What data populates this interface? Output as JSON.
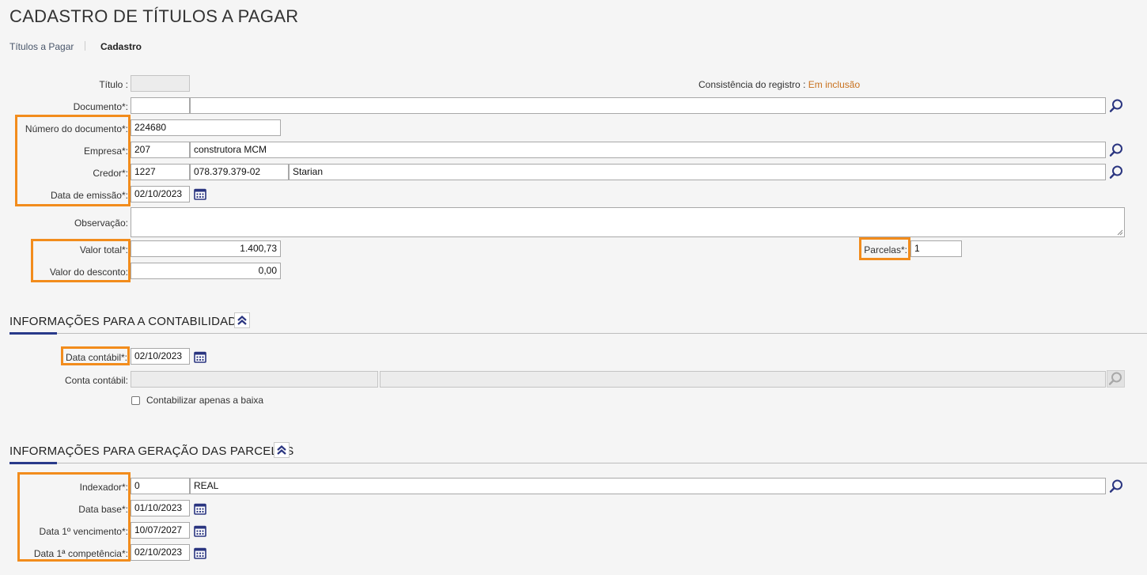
{
  "page": {
    "title": "CADASTRO DE TÍTULOS A PAGAR",
    "breadcrumb": {
      "parent": "Títulos a Pagar",
      "current": "Cadastro"
    }
  },
  "record": {
    "titulo_label": "Título :",
    "titulo_value": "",
    "consistencia_label": "Consistência do registro :",
    "consistencia_value": "Em inclusão",
    "documento_label": "Documento*:",
    "documento_code": "",
    "documento_desc": "",
    "numero_label": "Número do documento*:",
    "numero_value": "224680",
    "empresa_label": "Empresa*:",
    "empresa_code": "207",
    "empresa_name": "construtora MCM",
    "credor_label": "Credor*:",
    "credor_code": "1227",
    "credor_doc": "078.379.379-02",
    "credor_name": "Starian",
    "emissao_label": "Data de emissão*:",
    "emissao_value": "02/10/2023",
    "obs_label": "Observação:",
    "obs_value": "",
    "valor_total_label": "Valor total*:",
    "valor_total_value": "1.400,73",
    "desconto_label": "Valor do desconto:",
    "desconto_value": "0,00",
    "parcelas_label": "Parcelas*:",
    "parcelas_value": "1"
  },
  "contabilidade": {
    "section_title": "INFORMAÇÕES PARA A CONTABILIDADE",
    "data_label": "Data contábil*:",
    "data_value": "02/10/2023",
    "conta_label": "Conta contábil:",
    "conta_code": "",
    "conta_desc": "",
    "checkbox_label": "Contabilizar apenas a baixa",
    "checkbox_checked": false
  },
  "parcelas": {
    "section_title": "INFORMAÇÕES PARA GERAÇÃO DAS PARCELAS",
    "indexador_label": "Indexador*:",
    "indexador_code": "0",
    "indexador_name": "REAL",
    "data_base_label": "Data base*:",
    "data_base_value": "01/10/2023",
    "venc_label": "Data 1º vencimento*:",
    "venc_value": "10/07/2027",
    "comp_label": "Data 1ª competência*:",
    "comp_value": "02/10/2023"
  },
  "colors": {
    "highlight": "#f28c1c",
    "accent": "#293a8a",
    "status": "#c8711e"
  },
  "icons": [
    "search-icon",
    "calendar-icon",
    "chevron-double-up-icon"
  ]
}
